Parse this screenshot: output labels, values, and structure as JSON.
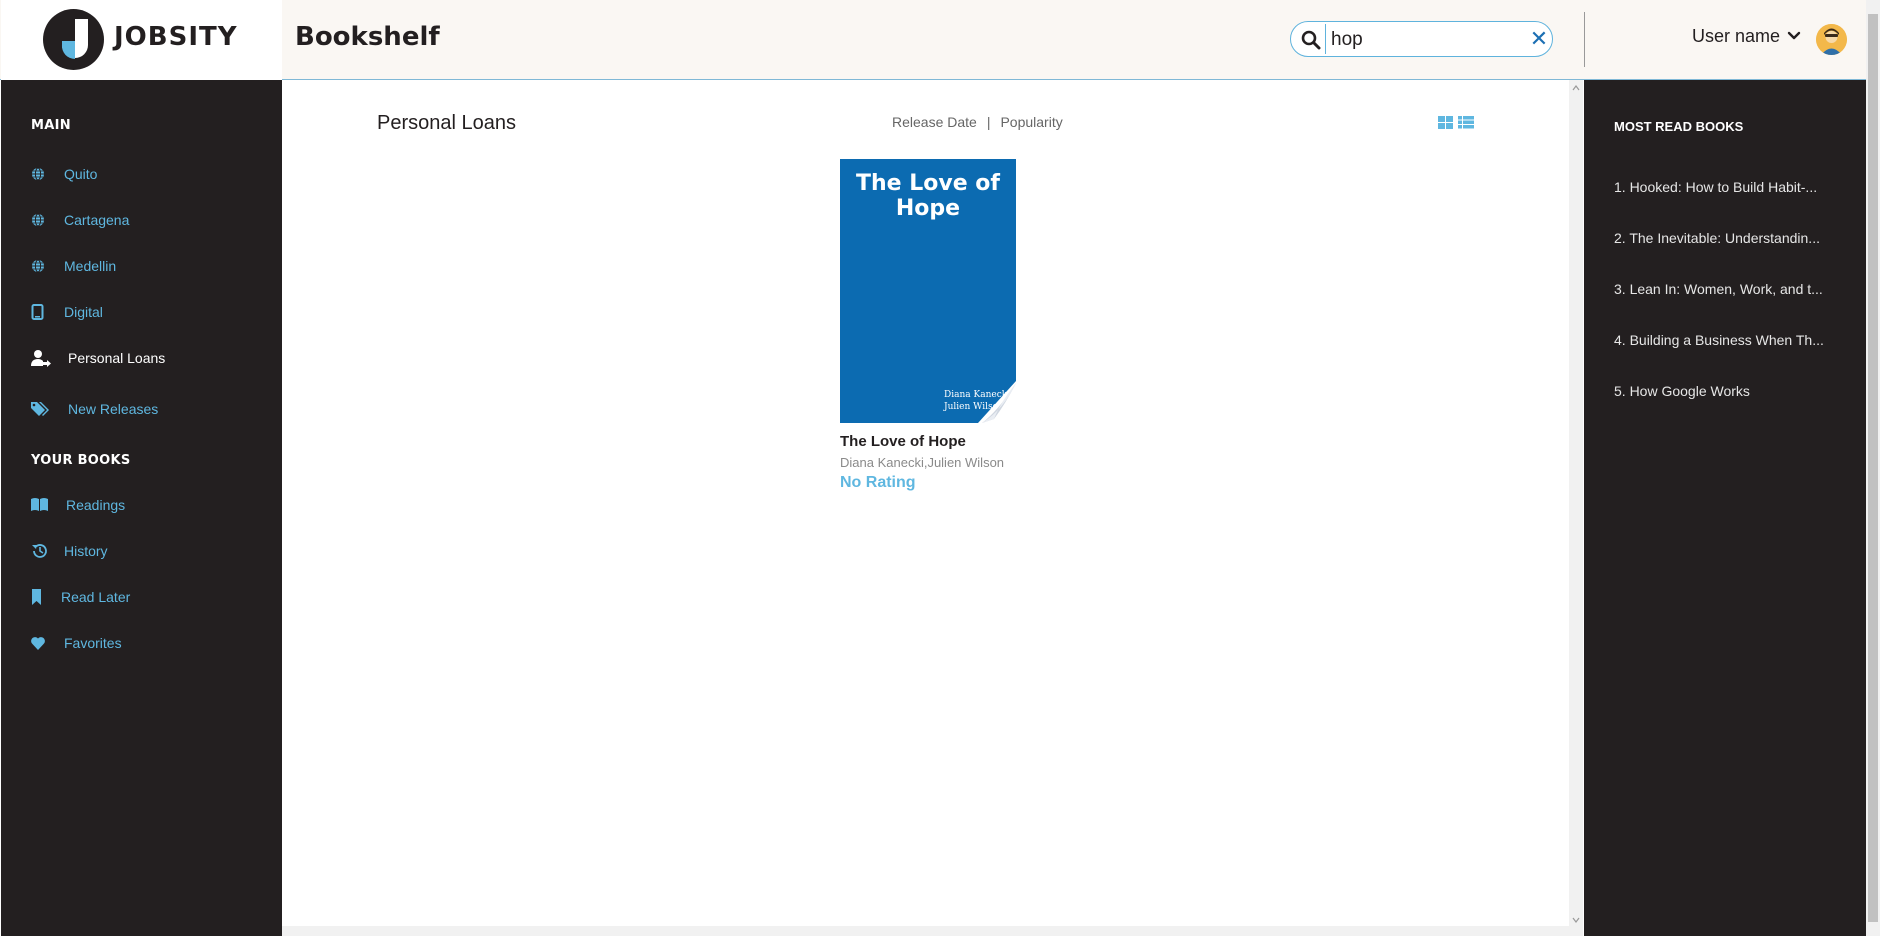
{
  "header": {
    "logo_text": "JOBSITY",
    "app_title": "Bookshelf",
    "search": {
      "value": "hop",
      "clear_label": "✕"
    },
    "user_name": "User name"
  },
  "sidebar": {
    "main_heading": "MAIN",
    "main_items": [
      {
        "label": "Quito",
        "icon": "globe-icon"
      },
      {
        "label": "Cartagena",
        "icon": "globe-icon"
      },
      {
        "label": "Medellin",
        "icon": "globe-icon"
      },
      {
        "label": "Digital",
        "icon": "tablet-icon"
      },
      {
        "label": "Personal Loans",
        "icon": "user-share-icon",
        "active": true
      },
      {
        "label": "New Releases",
        "icon": "tags-icon"
      }
    ],
    "your_books_heading": "YOUR BOOKS",
    "your_books_items": [
      {
        "label": "Readings",
        "icon": "book-open-icon"
      },
      {
        "label": "History",
        "icon": "history-icon"
      },
      {
        "label": "Read Later",
        "icon": "bookmark-icon"
      },
      {
        "label": "Favorites",
        "icon": "heart-icon"
      }
    ]
  },
  "main": {
    "title": "Personal Loans",
    "sort": {
      "release_date": "Release Date",
      "separator": "|",
      "popularity": "Popularity"
    },
    "books": [
      {
        "cover_title": "The Love of Hope",
        "cover_author_line1": "Diana Kanecki",
        "cover_author_line2": "Julien Wilson",
        "cover_color": "#0c6bb1",
        "title": "The Love of Hope",
        "authors": "Diana Kanecki,Julien Wilson",
        "rating": "No Rating"
      }
    ]
  },
  "right_sidebar": {
    "heading": "MOST READ BOOKS",
    "items": [
      "1. Hooked: How to Build Habit-...",
      "2. The Inevitable: Understandin...",
      "3. Lean In: Women, Work, and t...",
      "4. Building a Business When Th...",
      "5. How Google Works"
    ]
  },
  "colors": {
    "accent": "#5fb7e0",
    "dark": "#231f20",
    "header_bg": "#faf7f3",
    "cover_blue": "#0c6bb1"
  }
}
